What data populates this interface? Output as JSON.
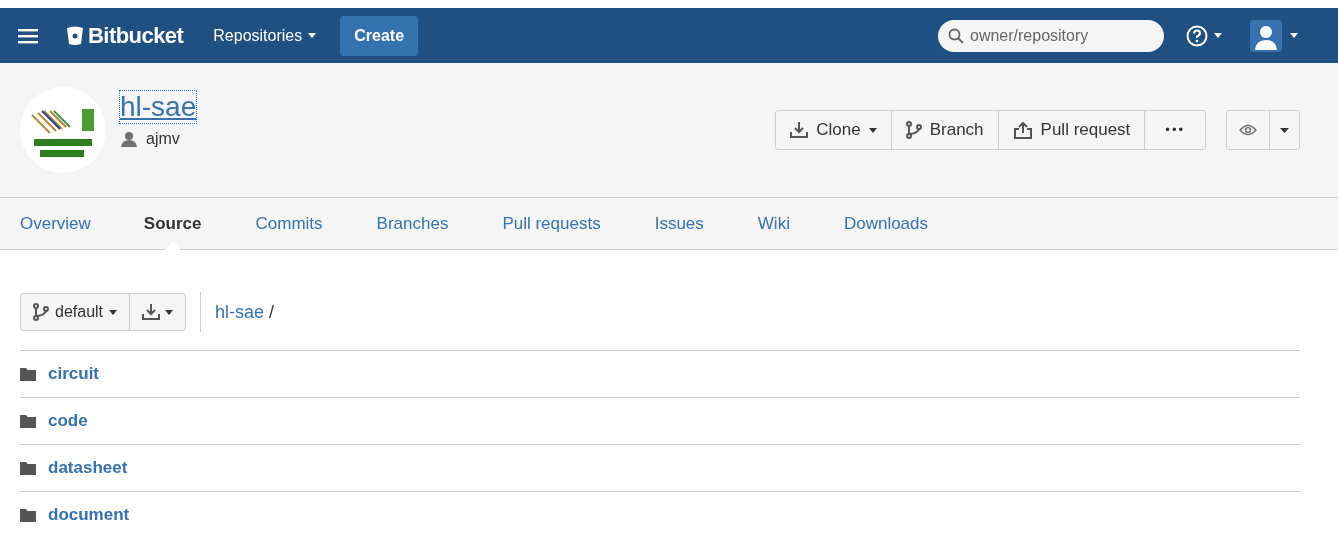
{
  "navbar": {
    "brand": "Bitbucket",
    "menu": "Repositories",
    "create": "Create",
    "search": {
      "placeholder": "owner/repository"
    }
  },
  "repo": {
    "name": "hl-sae",
    "owner": "ajmv"
  },
  "actions": [
    {
      "kind": "clone",
      "label": "Clone"
    },
    {
      "kind": "branch",
      "label": "Branch"
    },
    {
      "kind": "pull",
      "label": "Pull request"
    },
    {
      "kind": "more",
      "label": "•••"
    }
  ],
  "tabs": [
    {
      "label": "Overview",
      "selected": false
    },
    {
      "label": "Source",
      "selected": true
    },
    {
      "label": "Commits",
      "selected": false
    },
    {
      "label": "Branches",
      "selected": false
    },
    {
      "label": "Pull requests",
      "selected": false
    },
    {
      "label": "Issues",
      "selected": false
    },
    {
      "label": "Wiki",
      "selected": false
    },
    {
      "label": "Downloads",
      "selected": false
    }
  ],
  "source": {
    "branch": "default",
    "breadcrumb": "hl-sae",
    "separator": "/"
  },
  "files": [
    {
      "name": "circuit"
    },
    {
      "name": "code"
    },
    {
      "name": "datasheet"
    },
    {
      "name": "document"
    }
  ]
}
